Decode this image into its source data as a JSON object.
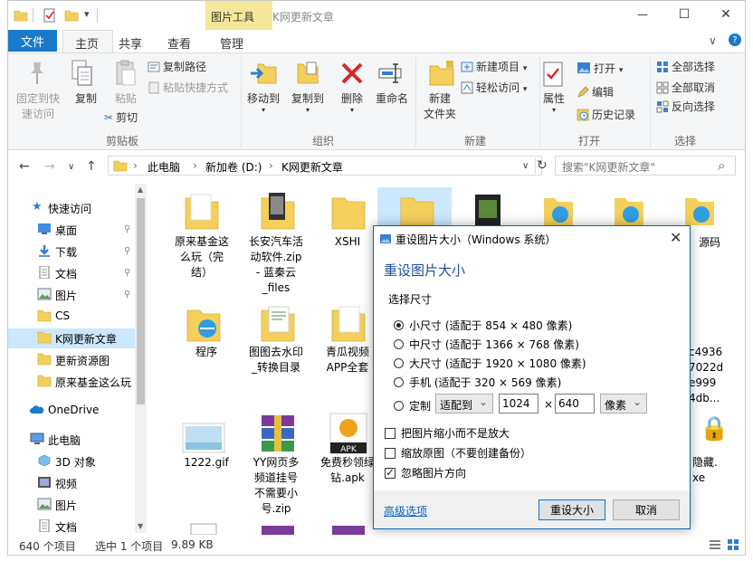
{
  "window": {
    "title": "K网更新文章",
    "context_tab_group": "图片工具",
    "caption": {
      "minimize": "—",
      "maximize": "☐",
      "close": "✕"
    },
    "qat_dropdown": "▾"
  },
  "ribbon_tabs": {
    "file": "文件",
    "home": "主页",
    "share": "共享",
    "view": "查看",
    "manage": "管理",
    "expand_icon": "∨",
    "help_icon": "?"
  },
  "ribbon": {
    "clipboard": {
      "label": "剪贴板",
      "pin_quick_access": [
        "固定到快",
        "速访问"
      ],
      "copy": "复制",
      "paste": "粘贴",
      "copy_path": "复制路径",
      "paste_shortcut": "粘贴快捷方式",
      "cut": "剪切"
    },
    "organize": {
      "label": "组织",
      "move_to": "移动到",
      "copy_to": "复制到",
      "delete": "删除",
      "rename": "重命名"
    },
    "new": {
      "label": "新建",
      "new_folder": [
        "新建",
        "文件夹"
      ],
      "new_item": "新建项目",
      "easy_access": "轻松访问"
    },
    "open": {
      "label": "打开",
      "properties": "属性",
      "open": "打开",
      "edit": "编辑",
      "history": "历史记录"
    },
    "select": {
      "label": "选择",
      "select_all": "全部选择",
      "select_none": "全部取消",
      "invert": "反向选择"
    }
  },
  "address": {
    "back": "←",
    "forward": "→",
    "recent": "∨",
    "up": "↑",
    "crumbs": [
      "此电脑",
      "新加卷 (D:)",
      "K网更新文章"
    ],
    "crumb_sep": "›",
    "dropdown": "∨",
    "refresh": "↻",
    "search_placeholder": "搜索\"K网更新文章\"",
    "search_icon": "⌕"
  },
  "nav": {
    "quick_access": "快速访问",
    "items": [
      "桌面",
      "下载",
      "文档",
      "图片",
      "CS",
      "K网更新文章",
      "更新资源图",
      "原来基金这么玩"
    ],
    "onedrive": "OneDrive",
    "this_pc": "此电脑",
    "pc_items": [
      "3D 对象",
      "视频",
      "图片",
      "文档"
    ],
    "pin_glyph": "📌",
    "scroll_up": "▲",
    "scroll_down": "▼"
  },
  "files": {
    "row1": [
      [
        "原来基金这",
        "么玩（完",
        "结）"
      ],
      [
        "长安汽车活",
        "动软件.zip",
        "- 蓝秦云",
        "_files"
      ],
      [
        "XSHI"
      ]
    ],
    "row2": [
      [
        "程序"
      ],
      [
        "图图去水印",
        "_转换目录"
      ],
      [
        "青瓜视频",
        "APP全套"
      ]
    ],
    "row3": [
      [
        "1222.gif"
      ],
      [
        "YY网页多",
        "频道挂号",
        "不需要小",
        "号.zip"
      ],
      [
        "免费秒领绿",
        "钻.apk"
      ]
    ],
    "right_partial": {
      "r1": "源码",
      "r2": [
        "c4936",
        "7022d",
        "e999",
        "4db..."
      ],
      "r3": [
        "隐藏.",
        "xe"
      ]
    }
  },
  "status": {
    "count": "640 个项目",
    "selection": "选中 1 个项目",
    "size": "9.89 KB"
  },
  "dialog": {
    "title": "重设图片大小（Windows 系统）",
    "close": "✕",
    "heading": "重设图片大小",
    "size_group": "选择尺寸",
    "options": [
      {
        "label": "小尺寸 (适配于 854 × 480 像素)",
        "checked": true
      },
      {
        "label": "中尺寸 (适配于 1366 × 768 像素)",
        "checked": false
      },
      {
        "label": "大尺寸 (适配于 1920 × 1080 像素)",
        "checked": false
      },
      {
        "label": "手机 (适配于 320 × 569 像素)",
        "checked": false
      }
    ],
    "custom": {
      "label": "定制",
      "fit_mode": "适配到",
      "width": "1024",
      "times": "×",
      "height": "640",
      "unit": "像素",
      "dropdown": "⌄"
    },
    "checkboxes": [
      {
        "label": "把图片缩小而不是放大",
        "checked": false
      },
      {
        "label": "缩放原图（不要创建备份）",
        "checked": false
      },
      {
        "label": "忽略图片方向",
        "checked": true
      }
    ],
    "advanced": "高级选项",
    "ok": "重设大小",
    "cancel": "取消"
  },
  "colors": {
    "accent": "#1979ca",
    "context_tab": "#f5e79a",
    "folder": "#f4cf5c",
    "dialog_heading": "#1e4f99",
    "selection": "#cce8ff"
  }
}
